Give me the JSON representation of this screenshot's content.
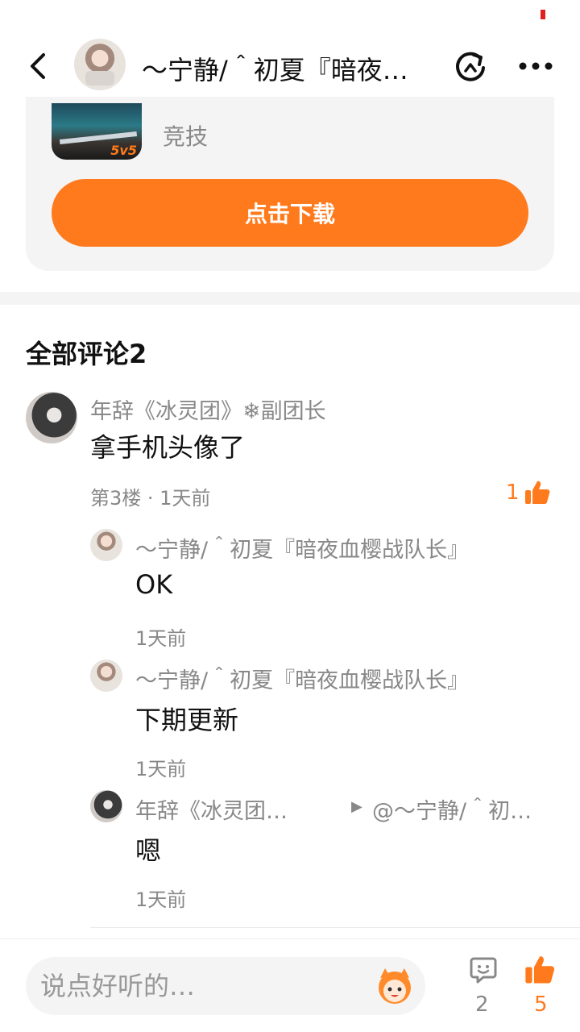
{
  "header": {
    "title": "～宁静/＾初夏『暗夜…"
  },
  "app_card": {
    "category": "竞技",
    "download_label": "点击下载",
    "icon_badge": "5v5"
  },
  "comments_section": {
    "title": "全部评论2"
  },
  "comment": {
    "author": "年辞《冰灵团》❄副团长",
    "text": "拿手机头像了",
    "meta": "第3楼 · 1天前",
    "likes": "1"
  },
  "replies": [
    {
      "author": "～宁静/＾初夏『暗夜血樱战队长』",
      "text": "OK",
      "time": "1天前"
    },
    {
      "author": "～宁静/＾初夏『暗夜血樱战队长』",
      "text": "下期更新",
      "time": "1天前"
    },
    {
      "author": "年辞《冰灵团…",
      "reply_to": "@～宁静/＾初…",
      "text": "嗯",
      "time": "1天前"
    }
  ],
  "bottom_bar": {
    "input_placeholder": "说点好听的…",
    "comment_count": "2",
    "like_count": "5"
  },
  "colors": {
    "accent": "#ff7a1c",
    "muted_text": "#888888",
    "card_bg": "#f4f4f4"
  },
  "icons": [
    "back-icon",
    "refresh-icon",
    "more-icon",
    "thumb-up-icon",
    "chat-icon",
    "mascot-icon"
  ]
}
